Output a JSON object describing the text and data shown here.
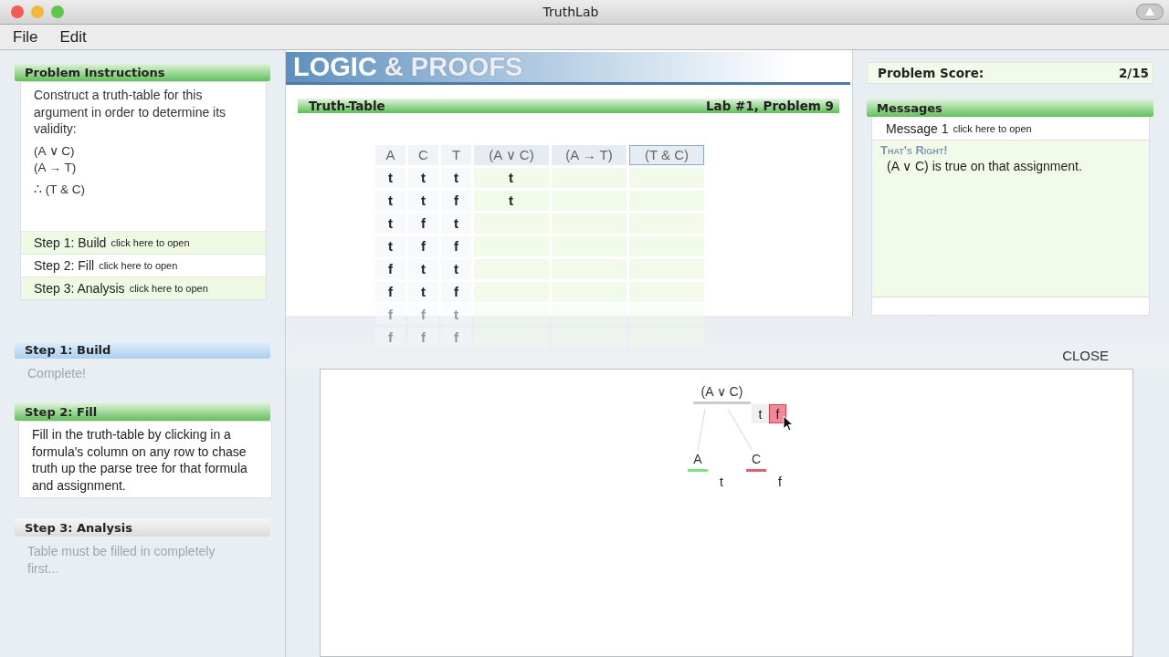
{
  "window": {
    "title": "TruthLab"
  },
  "menu": [
    "File",
    "Edit"
  ],
  "instructions": {
    "title": "Problem Instructions",
    "text": "Construct a truth-table for this argument in order to determine its validity:",
    "premises": [
      "(A ∨ C)",
      "(A → T)"
    ],
    "conclusion": "∴ (T & C)",
    "steps": [
      {
        "label": "Step 1: Build",
        "hint": "click here to open"
      },
      {
        "label": "Step 2: Fill",
        "hint": "click here to open"
      },
      {
        "label": "Step 3: Analysis",
        "hint": "click here to open"
      }
    ]
  },
  "step_sections": [
    {
      "title": "Step 1: Build",
      "kind": "complete",
      "text": "Complete!"
    },
    {
      "title": "Step 2: Fill",
      "kind": "active",
      "text": "Fill in the truth-table by clicking in a formula's column on any row to chase truth up the parse tree for that formula and assignment."
    },
    {
      "title": "Step 3: Analysis",
      "kind": "locked",
      "text": "Table must be filled in completely first..."
    }
  ],
  "logo": {
    "word1": "LOGIC",
    "amp": "&",
    "word2": "PROOFS"
  },
  "truth_table": {
    "title": "Truth-Table",
    "problem": "Lab #1, Problem 9",
    "columns": [
      {
        "label": "A",
        "kind": "atom",
        "selected": false
      },
      {
        "label": "C",
        "kind": "atom",
        "selected": false
      },
      {
        "label": "T",
        "kind": "atom",
        "selected": false
      },
      {
        "label": "(A ∨ C)",
        "kind": "formula",
        "selected": false
      },
      {
        "label": "(A → T)",
        "kind": "formula",
        "selected": false
      },
      {
        "label": "(T & C)",
        "kind": "formula",
        "selected": true
      }
    ],
    "rows": [
      {
        "atoms": [
          "t",
          "t",
          "t"
        ],
        "filled": [
          "t"
        ],
        "faded": false
      },
      {
        "atoms": [
          "t",
          "t",
          "f"
        ],
        "filled": [
          "t"
        ],
        "faded": false
      },
      {
        "atoms": [
          "t",
          "f",
          "t"
        ],
        "faded": false
      },
      {
        "atoms": [
          "t",
          "f",
          "f"
        ],
        "faded": false
      },
      {
        "atoms": [
          "f",
          "t",
          "t"
        ],
        "faded": false
      },
      {
        "atoms": [
          "f",
          "t",
          "f"
        ],
        "faded": false
      },
      {
        "atoms": [
          "f",
          "f",
          "t"
        ],
        "faded": true
      },
      {
        "atoms": [
          "f",
          "f",
          "f"
        ],
        "faded": true
      }
    ]
  },
  "score": {
    "label": "Problem Score:",
    "value": "2/15"
  },
  "messages": {
    "title": "Messages",
    "items": [
      {
        "label": "Message 1",
        "hint": "click here to open"
      }
    ],
    "heading": "That's Right!",
    "body": "(A ∨ C) is true on that assignment."
  },
  "close": "CLOSE",
  "parse_tree": {
    "formula": "(A ∨ C)",
    "options": [
      {
        "label": "t",
        "selected": false
      },
      {
        "label": "f",
        "selected": true
      }
    ],
    "children": [
      {
        "formula": "A",
        "value": "t",
        "color": "#7ee07e"
      },
      {
        "formula": "C",
        "value": "f",
        "color": "#e06070"
      }
    ]
  }
}
